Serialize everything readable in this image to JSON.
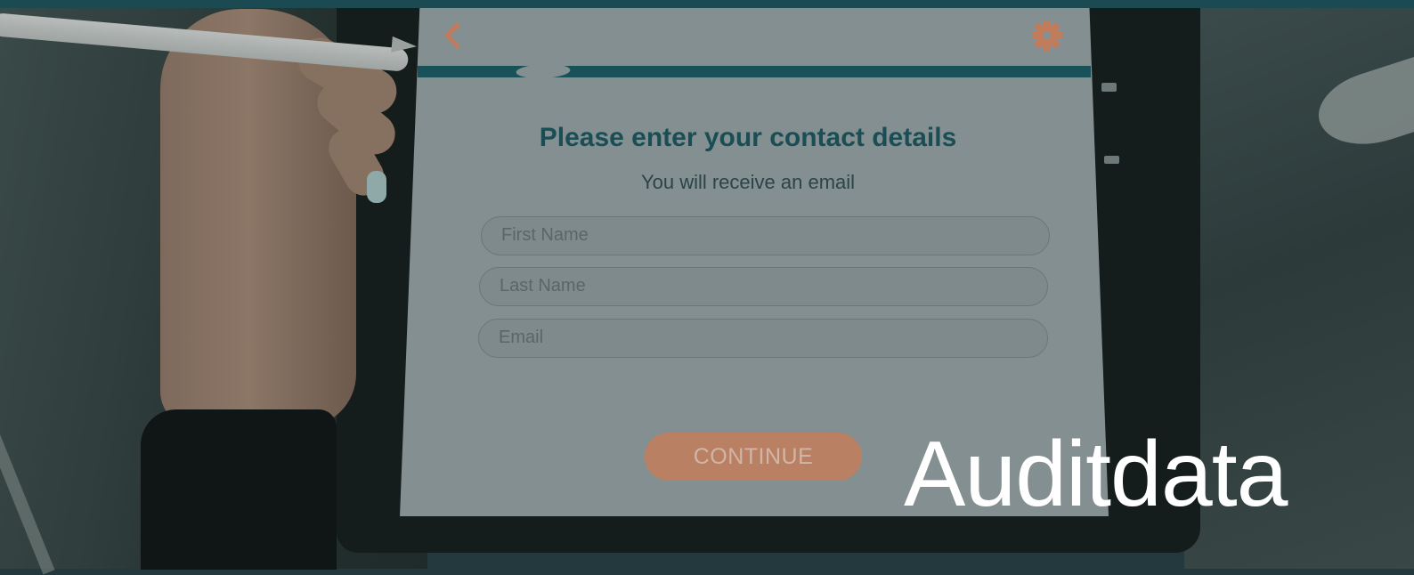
{
  "form": {
    "title": "Please enter your contact details",
    "subtitle": "You will receive an email",
    "fields": [
      {
        "placeholder": "First Name",
        "value": ""
      },
      {
        "placeholder": "Last Name",
        "value": ""
      },
      {
        "placeholder": "Email",
        "value": ""
      }
    ],
    "continue_label": "CONTINUE"
  },
  "nav": {
    "back_icon": "chevron-left-icon",
    "settings_icon": "gear-icon"
  },
  "brand": {
    "logo_text": "Auditdata"
  },
  "colors": {
    "accent": "#c27c5c",
    "brand_dark": "#185258",
    "overlay": "#23393d"
  }
}
